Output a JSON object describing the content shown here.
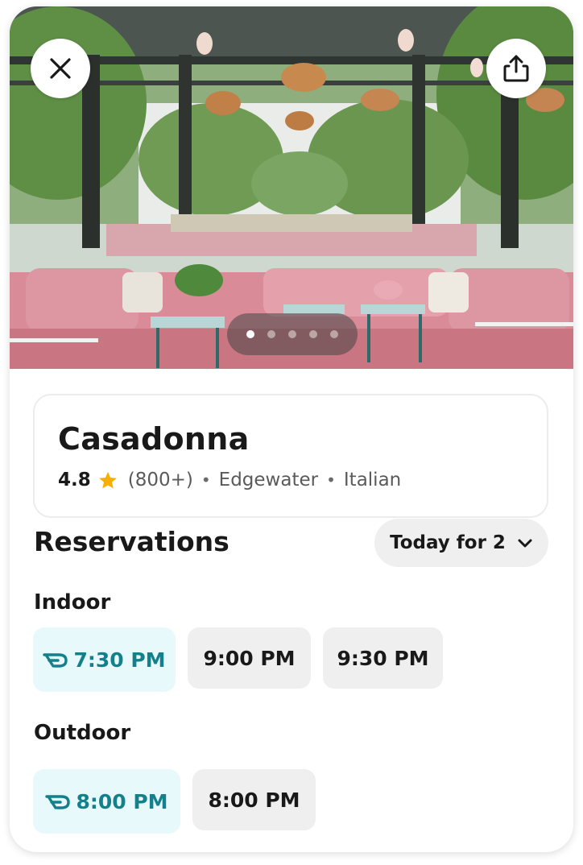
{
  "restaurant": {
    "name": "Casadonna",
    "rating": "4.8",
    "review_count": "(800+)",
    "neighborhood": "Edgewater",
    "cuisine": "Italian",
    "separator": "•"
  },
  "gallery": {
    "image_count": 5,
    "active_index": 0
  },
  "reservations": {
    "title": "Reservations",
    "party_selector": "Today for 2",
    "sections": [
      {
        "label": "Indoor",
        "slots": [
          {
            "time": "7:30 PM",
            "promoted": true
          },
          {
            "time": "9:00 PM",
            "promoted": false
          },
          {
            "time": "9:30 PM",
            "promoted": false
          }
        ]
      },
      {
        "label": "Outdoor",
        "slots": [
          {
            "time": "8:00 PM",
            "promoted": true
          },
          {
            "time": "8:00 PM",
            "promoted": false
          }
        ]
      }
    ]
  },
  "icons": {
    "close": "close-icon",
    "share": "share-icon",
    "star": "star-icon",
    "chevron": "chevron-down-icon",
    "promo": "dash-pass-icon"
  },
  "colors": {
    "accent_teal": "#13808b",
    "promo_bg": "#e8f9fb",
    "star": "#f5b000",
    "chip_bg": "#efefef"
  }
}
